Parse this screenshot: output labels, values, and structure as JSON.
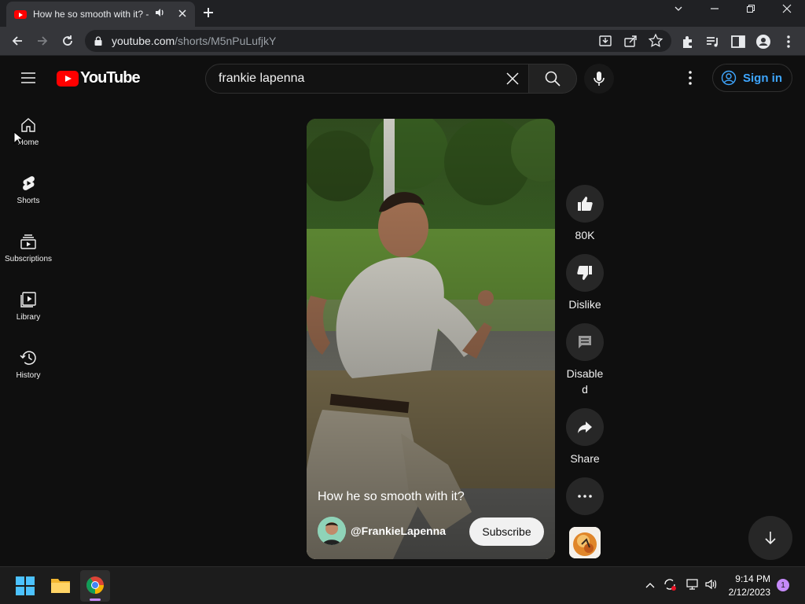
{
  "browser": {
    "tab_title": "How he so smooth with it? -",
    "url_host": "youtube.com",
    "url_path": "/shorts/M5nPuLufjkY"
  },
  "youtube": {
    "logo_text": "YouTube",
    "search": {
      "value": "frankie lapenna"
    },
    "signin_label": "Sign in",
    "guide": [
      {
        "label": "Home",
        "icon": "home-icon"
      },
      {
        "label": "Shorts",
        "icon": "shorts-icon"
      },
      {
        "label": "Subscriptions",
        "icon": "subscriptions-icon"
      },
      {
        "label": "Library",
        "icon": "library-icon"
      },
      {
        "label": "History",
        "icon": "history-icon"
      }
    ],
    "short": {
      "title": "How he so smooth with it?",
      "channel_handle": "@FrankieLapenna",
      "subscribe_label": "Subscribe"
    },
    "actions": {
      "like_count": "80K",
      "dislike_label": "Dislike",
      "comments_label": "Disabled",
      "share_label": "Share"
    }
  },
  "taskbar": {
    "time": "9:14 PM",
    "date": "2/12/2023",
    "notification_count": "1"
  },
  "colors": {
    "youtube_red": "#ff0000",
    "link_blue": "#3ea6ff",
    "background": "#0f0f0f"
  }
}
